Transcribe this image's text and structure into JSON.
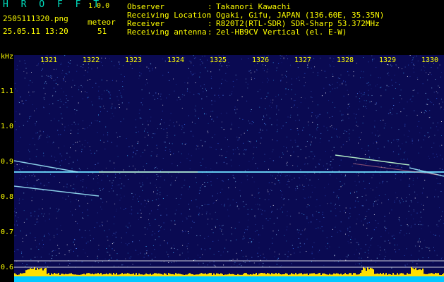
{
  "header": {
    "app_title": "H R O F F T",
    "version": "1.0.0",
    "filename": "2505111320.png",
    "datetime": "25.05.11 13:20",
    "meteor_label": "meteor",
    "meteor_count": "51"
  },
  "station": {
    "rows": [
      {
        "key": "Observer",
        "sep": ":",
        "value": "Takanori Kawachi"
      },
      {
        "key": "Receiving Location",
        "sep": ":",
        "value": "Ogaki, Gifu, JAPAN (136.60E, 35.35N)"
      },
      {
        "key": "Receiver",
        "sep": ":",
        "value": "R820T2(RTL-SDR) SDR-Sharp 53.372MHz"
      },
      {
        "key": "Receiving antenna",
        "sep": ":",
        "value": "2el-HB9CV Vertical (el. E-W)"
      }
    ]
  },
  "spectrogram": {
    "unit_label": "kHz",
    "x_ticks": [
      "1321",
      "1322",
      "1323",
      "1324",
      "1325",
      "1326",
      "1327",
      "1328",
      "1329",
      "1330"
    ],
    "y_ticks": [
      "1.1",
      "1.0",
      "0.9",
      "0.8",
      "0.7",
      "0.6"
    ],
    "colors": {
      "background": "#0a0a52",
      "text": "#ffff00",
      "title": "#00e0c0",
      "bars": "#ffe000",
      "bar_base": "#00c8ff"
    }
  }
}
